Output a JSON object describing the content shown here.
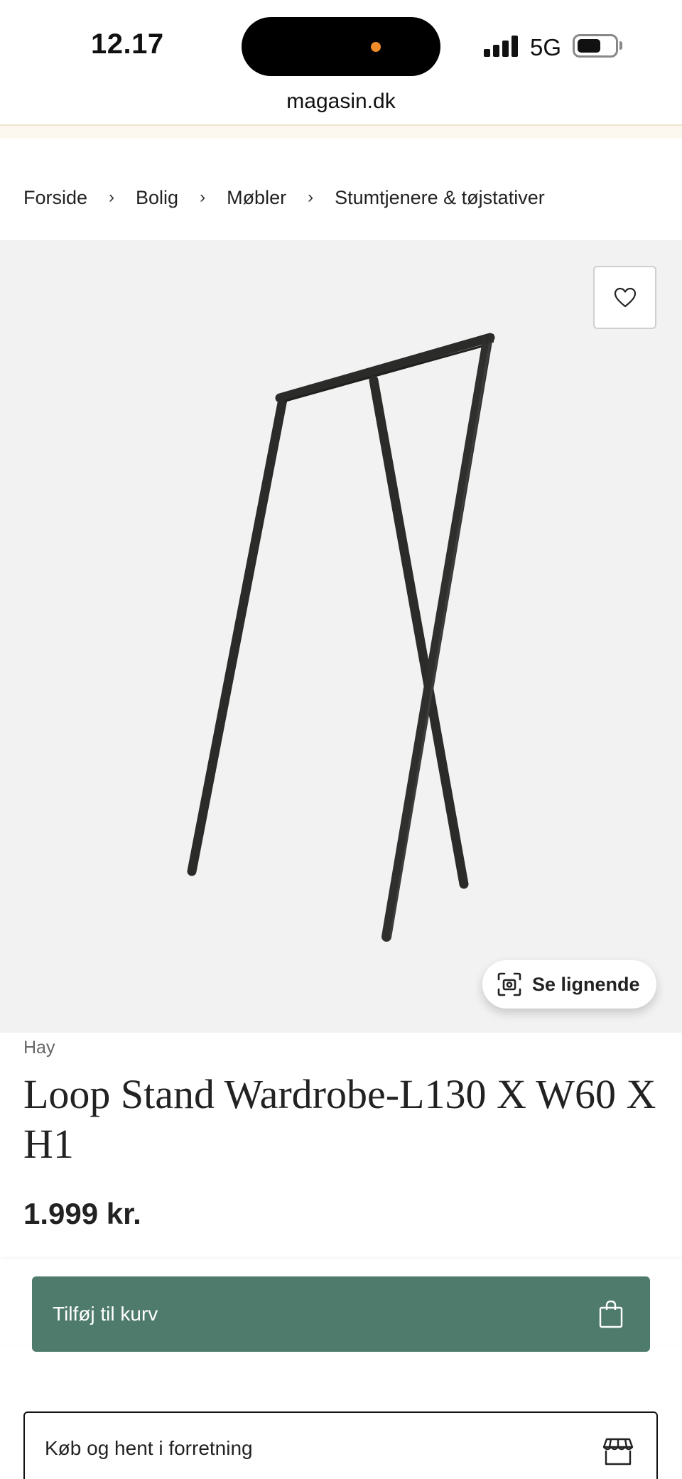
{
  "status_bar": {
    "time": "12.17",
    "network": "5G",
    "url": "magasin.dk",
    "island_dot_color": "#f08a2a"
  },
  "breadcrumb": {
    "items": [
      "Forside",
      "Bolig",
      "Møbler",
      "Stumtjenere & tøjstativer"
    ],
    "separator": "›"
  },
  "product_image": {
    "background_color": "#f2f2f2",
    "favorite_icon": "heart-icon",
    "similar_icon": "visual-search-icon",
    "similar_label": "Se lignende"
  },
  "product": {
    "brand": "Hay",
    "title": "Loop Stand Wardrobe-L130 X W60 X H1",
    "price": "1.999 kr."
  },
  "actions": {
    "add_to_cart_label": "Tilføj til kurv",
    "add_to_cart_icon": "shopping-bag-icon",
    "add_to_cart_color": "#4e7b6b",
    "store_pickup_label": "Køb og hent i forretning",
    "store_pickup_icon": "storefront-icon"
  }
}
